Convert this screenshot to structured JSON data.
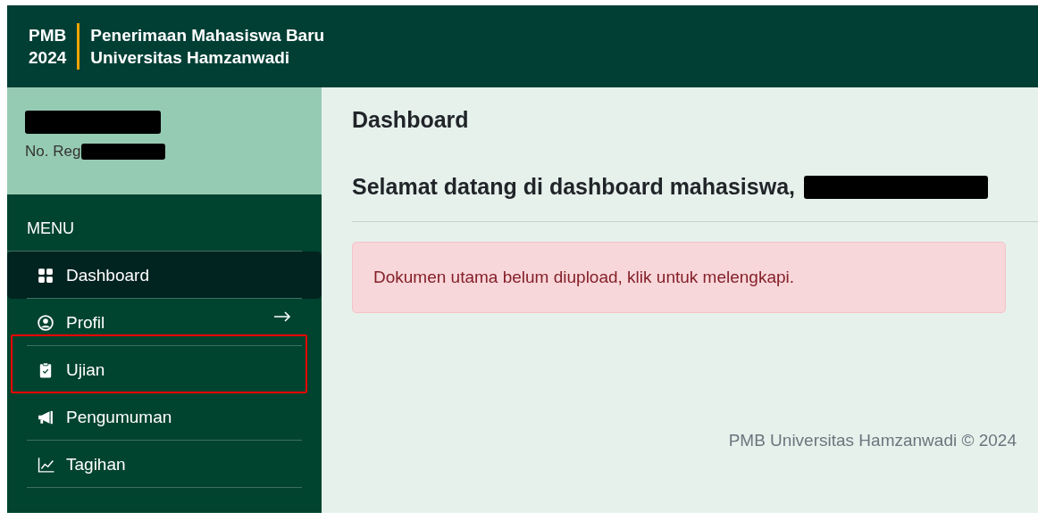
{
  "header": {
    "short_title": "PMB",
    "year": "2024",
    "title_line_1": "Penerimaan Mahasiswa Baru",
    "title_line_2": "Universitas Hamzanwadi"
  },
  "profile": {
    "name_redacted": true,
    "reg_label": "No. Reg",
    "reg_redacted": true
  },
  "menu": {
    "heading": "MENU",
    "items": [
      {
        "label": "Dashboard",
        "kind": "grid",
        "selected": true,
        "hovered": false,
        "highlighted": false
      },
      {
        "label": "Profil",
        "kind": "person",
        "selected": false,
        "hovered": true,
        "highlighted": false
      },
      {
        "label": "Ujian",
        "kind": "clipboard",
        "selected": false,
        "hovered": false,
        "highlighted": true
      },
      {
        "label": "Pengumuman",
        "kind": "megaphone",
        "selected": false,
        "hovered": false,
        "highlighted": false
      },
      {
        "label": "Tagihan",
        "kind": "chart",
        "selected": false,
        "hovered": false,
        "highlighted": false
      }
    ]
  },
  "main": {
    "page_title": "Dashboard",
    "welcome": "Selamat datang di dashboard mahasiswa,",
    "welcome_name_redacted": true,
    "alert": "Dokumen utama belum diupload, klik untuk melengkapi.",
    "footer": "PMB Universitas Hamzanwadi © 2024"
  }
}
